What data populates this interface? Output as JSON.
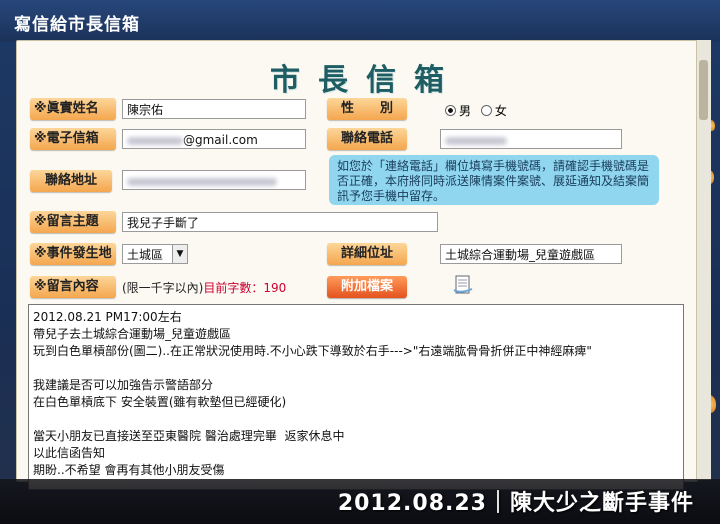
{
  "app_title": "寫信給市長信箱",
  "form_title": "市長信箱",
  "fields": {
    "name": {
      "label": "※眞實姓名",
      "value": "陳宗佑"
    },
    "gender": {
      "label": "性　　別",
      "options": [
        "男",
        "女"
      ],
      "selected": "男"
    },
    "email": {
      "label": "※電子信箱",
      "value_suffix": "@gmail.com"
    },
    "phone": {
      "label": "聯絡電話"
    },
    "address": {
      "label": "聯絡地址"
    },
    "subject": {
      "label": "※留言主題",
      "value": "我兒子手斷了"
    },
    "location": {
      "label": "※事件發生地",
      "value": "土城區"
    },
    "detail_location": {
      "label": "詳細位址",
      "value": "土城綜合運動場_兒童遊戲區"
    },
    "content": {
      "label": "※留言內容",
      "limit_hint": "(限一千字以內)",
      "count_label": "目前字數：",
      "count": "190"
    }
  },
  "note": "如您於「連絡電話」欄位填寫手機號碼，請確認手機號碼是否正確，本府將同時派送陳情案件案號、展延通知及結案簡訊予您手機中留存。",
  "attach_label": "附加檔案",
  "message": "2012.08.21 PM17:00左右\n帶兒子去土城綜合運動場_兒童遊戲區\n玩到白色單槓部份(圖二)..在正常狀況使用時.不小心跌下導致於右手--->\"右遠端肱骨骨折併正中神經麻痺\"\n\n我建議是否可以加強告示警語部分\n在白色單槓底下 安全裝置(雖有軟墊但已經硬化)\n\n當天小朋友已直接送至亞東醫院 醫治處理完畢  返家休息中\n以此信函告知\n期盼..不希望 會再有其他小朋友受傷",
  "caption": "2012.08.23｜陳大少之斷手事件",
  "colors": {
    "label_bg": "#f4a64d",
    "title_teal": "#1d5d63",
    "note_bg": "#8fd6ee",
    "attach_btn": "#e4521e"
  }
}
